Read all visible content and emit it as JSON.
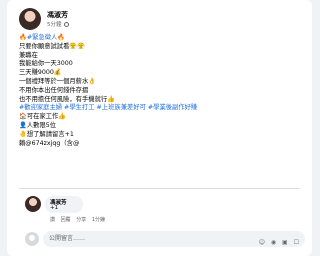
{
  "post": {
    "author": "馮淑芳",
    "time": "5分鐘",
    "lines": [
      {
        "text": "🔥#緊急徵人🔥",
        "tag": true
      },
      {
        "text": "只要你願意試試看😤😤",
        "tag": false
      },
      {
        "text": "兼職在",
        "tag": false
      },
      {
        "text": "我能給你一天3000",
        "tag": false
      },
      {
        "text": "三天賺9000💰",
        "tag": false
      },
      {
        "text": "一個禮拜等於一個月薪水👌",
        "tag": false
      },
      {
        "text": "不用你本出任何錢件存摺",
        "tag": false
      },
      {
        "text": "也不用擔任何風險，有手機就行👍",
        "tag": false
      },
      {
        "text": "#歡迎家庭主婦 #學生打工 #上班族兼差好可 #學業後副作好賺",
        "tag": true
      },
      {
        "text": "🏠可在家工作👍",
        "tag": false
      },
      {
        "text": "👤人數限5位",
        "tag": false
      },
      {
        "text": "🤚想了解請留言+1",
        "tag": false
      },
      {
        "text": "賴@674zxjqg（含@",
        "tag": false
      }
    ]
  },
  "comment": {
    "name": "馮淑芳",
    "text": "+1",
    "like": "讚",
    "reply": "回覆",
    "share": "分享",
    "time": "1分鐘"
  },
  "composer": {
    "placeholder": "公開留言……",
    "tools": "☺ ◉ ▣ ☐"
  }
}
